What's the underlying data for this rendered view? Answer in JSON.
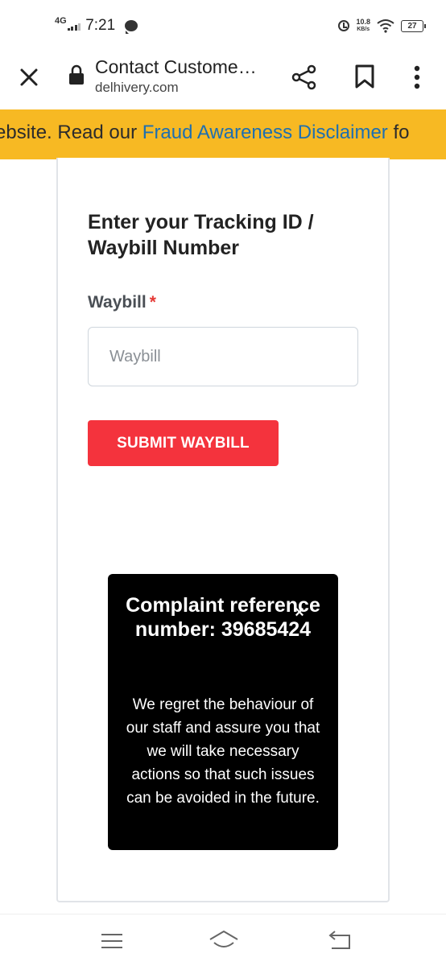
{
  "status_bar": {
    "network_type": "4G",
    "time": "7:21",
    "net_speed_value": "10.8",
    "net_speed_unit": "KB/s",
    "battery_level": "27"
  },
  "browser": {
    "page_title": "Contact Custome…",
    "domain": "delhivery.com"
  },
  "banner": {
    "text_before": "ebsite. Read our ",
    "link_text": "Fraud Awareness Disclaimer",
    "text_after": " fo"
  },
  "form": {
    "heading": "Enter your Tracking ID / Waybill Number",
    "label": "Waybill",
    "required_marker": "*",
    "input_value": "",
    "input_placeholder": "Waybill",
    "submit_label": "SUBMIT WAYBILL"
  },
  "toast": {
    "title": "Complaint reference number: 39685424",
    "close_glyph": "×",
    "message": "We regret the behaviour of our staff and assure you that we will take necessary actions so that such issues can be avoided in the future."
  },
  "colors": {
    "banner_bg": "#f7b923",
    "banner_link": "#1e6fb0",
    "submit_button": "#f4333d",
    "toast_bg": "#000000",
    "required_star": "#e53935"
  },
  "icons": {
    "status": [
      "signal-icon",
      "chat-notification-icon",
      "alarm-icon",
      "wifi-icon",
      "battery-icon"
    ],
    "toolbar": [
      "close-icon",
      "lock-icon",
      "share-icon",
      "bookmark-icon",
      "more-vert-icon"
    ],
    "nav": [
      "menu-icon",
      "home-icon",
      "back-icon"
    ]
  }
}
